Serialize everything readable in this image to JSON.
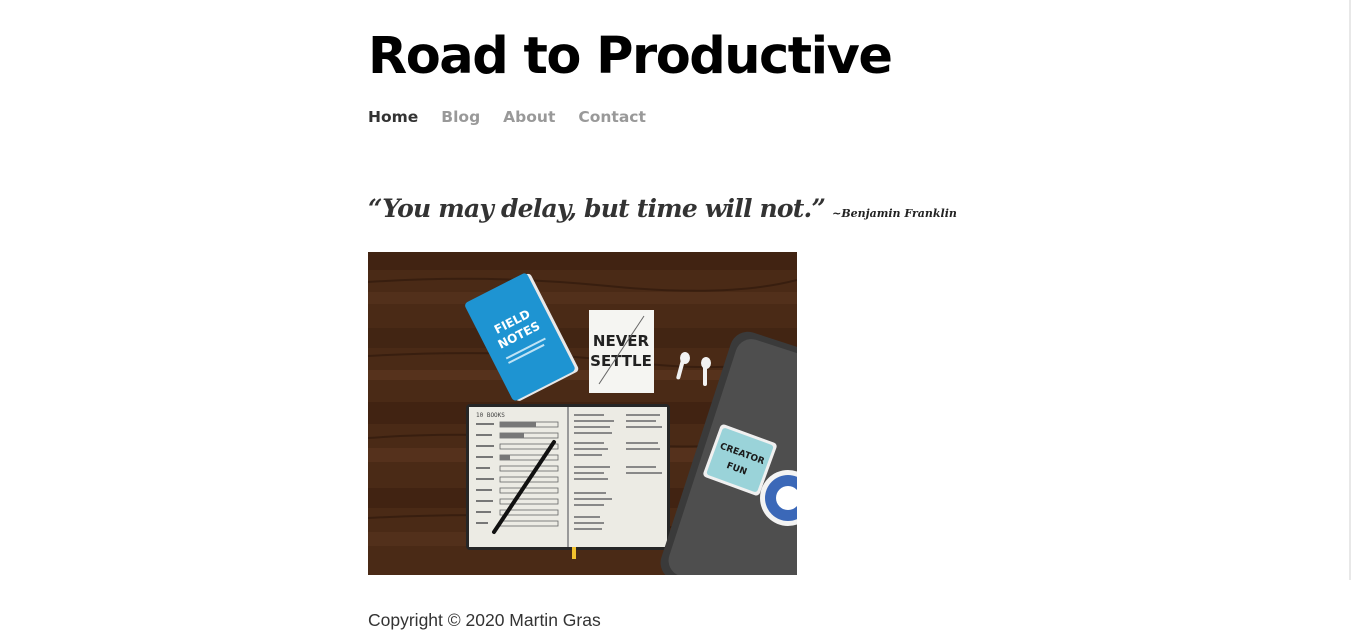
{
  "site": {
    "title": "Road to Productive"
  },
  "nav": {
    "items": [
      {
        "label": "Home",
        "active": true
      },
      {
        "label": "Blog",
        "active": false
      },
      {
        "label": "About",
        "active": false
      },
      {
        "label": "Contact",
        "active": false
      }
    ]
  },
  "quote": {
    "text": "“You may delay, but time will not.”",
    "author": "~Benjamin Franklin"
  },
  "hero_image": {
    "notebook_cover_line1": "FIELD",
    "notebook_cover_line2": "NOTES",
    "card_line1": "NEVER",
    "card_line2": "SETTLE",
    "planner_heading": "10 BOOKS",
    "sticker_line1": "CREATOR",
    "sticker_line2": "FUN"
  },
  "footer": {
    "copyright": "Copyright © 2020 Martin Gras"
  },
  "colors": {
    "title": "#000000",
    "nav_active": "#333333",
    "nav_inactive": "#999999",
    "wood": "#4a2a16",
    "notebook_blue": "#1e94d2"
  }
}
